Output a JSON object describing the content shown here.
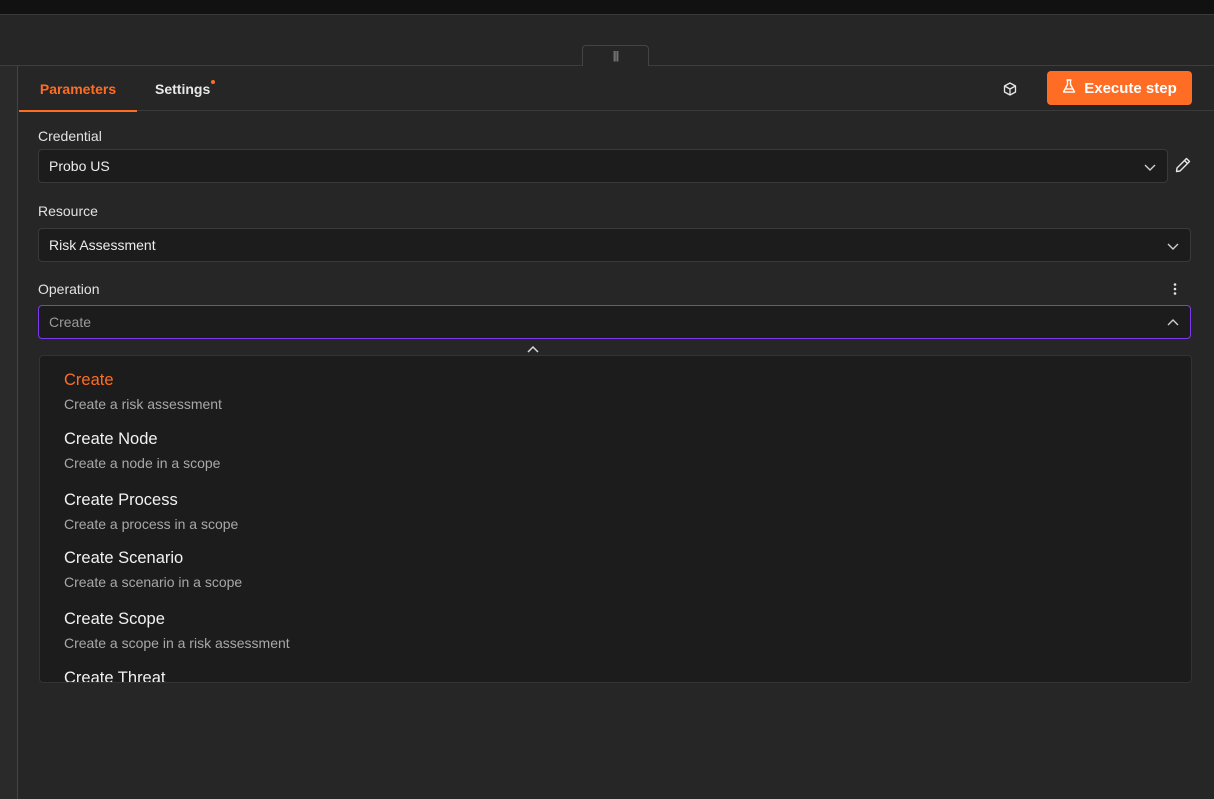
{
  "tabs": {
    "parameters": "Parameters",
    "settings": "Settings"
  },
  "toolbar": {
    "execute_label": "Execute step",
    "cube_icon": "cube-icon",
    "flask_icon": "flask-icon"
  },
  "credential": {
    "label": "Credential",
    "value": "Probo US"
  },
  "resource": {
    "label": "Resource",
    "value": "Risk Assessment"
  },
  "operation": {
    "label": "Operation",
    "placeholder": "Create",
    "value": ""
  },
  "dropdown": {
    "options": [
      {
        "title": "Create",
        "desc": "Create a risk assessment"
      },
      {
        "title": "Create Node",
        "desc": "Create a node in a scope"
      },
      {
        "title": "Create Process",
        "desc": "Create a process in a scope"
      },
      {
        "title": "Create Scenario",
        "desc": "Create a scenario in a scope"
      },
      {
        "title": "Create Scope",
        "desc": "Create a scope in a risk assessment"
      },
      {
        "title": "Create Threat",
        "desc": ""
      }
    ]
  },
  "colors": {
    "accent": "#ff6d24",
    "focus": "#7c3aed"
  }
}
